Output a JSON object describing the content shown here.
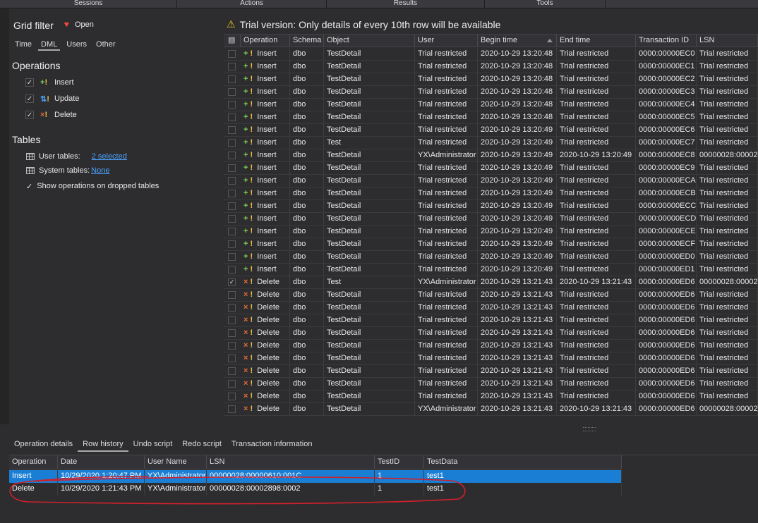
{
  "top_tabs": [
    "Sessions",
    "Actions",
    "Results",
    "Tools"
  ],
  "filter": {
    "title": "Grid filter",
    "open_label": "Open",
    "tabs": [
      "Time",
      "DML",
      "Users",
      "Other"
    ],
    "operations_heading": "Operations",
    "operations": [
      {
        "label": "Insert",
        "checked": true,
        "icon": "insert-icon"
      },
      {
        "label": "Update",
        "checked": true,
        "icon": "update-icon"
      },
      {
        "label": "Delete",
        "checked": true,
        "icon": "delete-icon"
      }
    ],
    "tables_heading": "Tables",
    "user_tables_label": "User tables:",
    "user_tables_value": "2 selected",
    "system_tables_label": "System tables:",
    "system_tables_value": "None",
    "show_dropped_label": "Show operations on dropped tables"
  },
  "banner": "Trial version: Only details of every 10th row will be available",
  "grid": {
    "columns": [
      "Operation",
      "Schema",
      "Object",
      "User",
      "Begin time",
      "End time",
      "Transaction ID",
      "LSN"
    ],
    "rows": [
      {
        "op": "Insert",
        "schema": "dbo",
        "object": "TestDetail",
        "user": "Trial restricted",
        "begin": "2020-10-29 13:20:48",
        "end": "Trial restricted",
        "tid": "0000:00000EC0",
        "lsn": "Trial restricted",
        "checked": false
      },
      {
        "op": "Insert",
        "schema": "dbo",
        "object": "TestDetail",
        "user": "Trial restricted",
        "begin": "2020-10-29 13:20:48",
        "end": "Trial restricted",
        "tid": "0000:00000EC1",
        "lsn": "Trial restricted",
        "checked": false
      },
      {
        "op": "Insert",
        "schema": "dbo",
        "object": "TestDetail",
        "user": "Trial restricted",
        "begin": "2020-10-29 13:20:48",
        "end": "Trial restricted",
        "tid": "0000:00000EC2",
        "lsn": "Trial restricted",
        "checked": false
      },
      {
        "op": "Insert",
        "schema": "dbo",
        "object": "TestDetail",
        "user": "Trial restricted",
        "begin": "2020-10-29 13:20:48",
        "end": "Trial restricted",
        "tid": "0000:00000EC3",
        "lsn": "Trial restricted",
        "checked": false
      },
      {
        "op": "Insert",
        "schema": "dbo",
        "object": "TestDetail",
        "user": "Trial restricted",
        "begin": "2020-10-29 13:20:48",
        "end": "Trial restricted",
        "tid": "0000:00000EC4",
        "lsn": "Trial restricted",
        "checked": false
      },
      {
        "op": "Insert",
        "schema": "dbo",
        "object": "TestDetail",
        "user": "Trial restricted",
        "begin": "2020-10-29 13:20:48",
        "end": "Trial restricted",
        "tid": "0000:00000EC5",
        "lsn": "Trial restricted",
        "checked": false
      },
      {
        "op": "Insert",
        "schema": "dbo",
        "object": "TestDetail",
        "user": "Trial restricted",
        "begin": "2020-10-29 13:20:49",
        "end": "Trial restricted",
        "tid": "0000:00000EC6",
        "lsn": "Trial restricted",
        "checked": false
      },
      {
        "op": "Insert",
        "schema": "dbo",
        "object": "Test",
        "user": "Trial restricted",
        "begin": "2020-10-29 13:20:49",
        "end": "Trial restricted",
        "tid": "0000:00000EC7",
        "lsn": "Trial restricted",
        "checked": false
      },
      {
        "op": "Insert",
        "schema": "dbo",
        "object": "TestDetail",
        "user": "YX\\Administrator",
        "begin": "2020-10-29 13:20:49",
        "end": "2020-10-29 13:20:49",
        "tid": "0000:00000EC8",
        "lsn": "00000028:00002",
        "checked": false
      },
      {
        "op": "Insert",
        "schema": "dbo",
        "object": "TestDetail",
        "user": "Trial restricted",
        "begin": "2020-10-29 13:20:49",
        "end": "Trial restricted",
        "tid": "0000:00000EC9",
        "lsn": "Trial restricted",
        "checked": false
      },
      {
        "op": "Insert",
        "schema": "dbo",
        "object": "TestDetail",
        "user": "Trial restricted",
        "begin": "2020-10-29 13:20:49",
        "end": "Trial restricted",
        "tid": "0000:00000ECA",
        "lsn": "Trial restricted",
        "checked": false
      },
      {
        "op": "Insert",
        "schema": "dbo",
        "object": "TestDetail",
        "user": "Trial restricted",
        "begin": "2020-10-29 13:20:49",
        "end": "Trial restricted",
        "tid": "0000:00000ECB",
        "lsn": "Trial restricted",
        "checked": false
      },
      {
        "op": "Insert",
        "schema": "dbo",
        "object": "TestDetail",
        "user": "Trial restricted",
        "begin": "2020-10-29 13:20:49",
        "end": "Trial restricted",
        "tid": "0000:00000ECC",
        "lsn": "Trial restricted",
        "checked": false
      },
      {
        "op": "Insert",
        "schema": "dbo",
        "object": "TestDetail",
        "user": "Trial restricted",
        "begin": "2020-10-29 13:20:49",
        "end": "Trial restricted",
        "tid": "0000:00000ECD",
        "lsn": "Trial restricted",
        "checked": false
      },
      {
        "op": "Insert",
        "schema": "dbo",
        "object": "TestDetail",
        "user": "Trial restricted",
        "begin": "2020-10-29 13:20:49",
        "end": "Trial restricted",
        "tid": "0000:00000ECE",
        "lsn": "Trial restricted",
        "checked": false
      },
      {
        "op": "Insert",
        "schema": "dbo",
        "object": "TestDetail",
        "user": "Trial restricted",
        "begin": "2020-10-29 13:20:49",
        "end": "Trial restricted",
        "tid": "0000:00000ECF",
        "lsn": "Trial restricted",
        "checked": false
      },
      {
        "op": "Insert",
        "schema": "dbo",
        "object": "TestDetail",
        "user": "Trial restricted",
        "begin": "2020-10-29 13:20:49",
        "end": "Trial restricted",
        "tid": "0000:00000ED0",
        "lsn": "Trial restricted",
        "checked": false
      },
      {
        "op": "Insert",
        "schema": "dbo",
        "object": "TestDetail",
        "user": "Trial restricted",
        "begin": "2020-10-29 13:20:49",
        "end": "Trial restricted",
        "tid": "0000:00000ED1",
        "lsn": "Trial restricted",
        "checked": false
      },
      {
        "op": "Delete",
        "schema": "dbo",
        "object": "Test",
        "user": "YX\\Administrator",
        "begin": "2020-10-29 13:21:43",
        "end": "2020-10-29 13:21:43",
        "tid": "0000:00000ED6",
        "lsn": "00000028:00002",
        "checked": true
      },
      {
        "op": "Delete",
        "schema": "dbo",
        "object": "TestDetail",
        "user": "Trial restricted",
        "begin": "2020-10-29 13:21:43",
        "end": "Trial restricted",
        "tid": "0000:00000ED6",
        "lsn": "Trial restricted",
        "checked": false
      },
      {
        "op": "Delete",
        "schema": "dbo",
        "object": "TestDetail",
        "user": "Trial restricted",
        "begin": "2020-10-29 13:21:43",
        "end": "Trial restricted",
        "tid": "0000:00000ED6",
        "lsn": "Trial restricted",
        "checked": false
      },
      {
        "op": "Delete",
        "schema": "dbo",
        "object": "TestDetail",
        "user": "Trial restricted",
        "begin": "2020-10-29 13:21:43",
        "end": "Trial restricted",
        "tid": "0000:00000ED6",
        "lsn": "Trial restricted",
        "checked": false
      },
      {
        "op": "Delete",
        "schema": "dbo",
        "object": "TestDetail",
        "user": "Trial restricted",
        "begin": "2020-10-29 13:21:43",
        "end": "Trial restricted",
        "tid": "0000:00000ED6",
        "lsn": "Trial restricted",
        "checked": false
      },
      {
        "op": "Delete",
        "schema": "dbo",
        "object": "TestDetail",
        "user": "Trial restricted",
        "begin": "2020-10-29 13:21:43",
        "end": "Trial restricted",
        "tid": "0000:00000ED6",
        "lsn": "Trial restricted",
        "checked": false
      },
      {
        "op": "Delete",
        "schema": "dbo",
        "object": "TestDetail",
        "user": "Trial restricted",
        "begin": "2020-10-29 13:21:43",
        "end": "Trial restricted",
        "tid": "0000:00000ED6",
        "lsn": "Trial restricted",
        "checked": false
      },
      {
        "op": "Delete",
        "schema": "dbo",
        "object": "TestDetail",
        "user": "Trial restricted",
        "begin": "2020-10-29 13:21:43",
        "end": "Trial restricted",
        "tid": "0000:00000ED6",
        "lsn": "Trial restricted",
        "checked": false
      },
      {
        "op": "Delete",
        "schema": "dbo",
        "object": "TestDetail",
        "user": "Trial restricted",
        "begin": "2020-10-29 13:21:43",
        "end": "Trial restricted",
        "tid": "0000:00000ED6",
        "lsn": "Trial restricted",
        "checked": false
      },
      {
        "op": "Delete",
        "schema": "dbo",
        "object": "TestDetail",
        "user": "Trial restricted",
        "begin": "2020-10-29 13:21:43",
        "end": "Trial restricted",
        "tid": "0000:00000ED6",
        "lsn": "Trial restricted",
        "checked": false
      },
      {
        "op": "Delete",
        "schema": "dbo",
        "object": "TestDetail",
        "user": "YX\\Administrator",
        "begin": "2020-10-29 13:21:43",
        "end": "2020-10-29 13:21:43",
        "tid": "0000:00000ED6",
        "lsn": "00000028:00002",
        "checked": false
      }
    ]
  },
  "bottom": {
    "tabs": [
      "Operation details",
      "Row history",
      "Undo script",
      "Redo script",
      "Transaction information"
    ],
    "active_tab": 1,
    "columns": [
      "Operation",
      "Date",
      "User Name",
      "LSN",
      "TestID",
      "TestData"
    ],
    "rows": [
      {
        "op": "Insert",
        "date": "10/29/2020 1:20:47 PM",
        "user": "YX\\Administrator",
        "lsn": "00000028:00000610:001C",
        "testid": "1",
        "testdata": "test1",
        "selected": true
      },
      {
        "op": "Delete",
        "date": "10/29/2020 1:21:43 PM",
        "user": "YX\\Administrator",
        "lsn": "00000028:00002898:0002",
        "testid": "1",
        "testdata": "test1",
        "selected": false
      }
    ]
  },
  "colors": {
    "selection": "#1a7fd4",
    "annotation": "#d0202a",
    "insert": "#7ed35a",
    "delete": "#e46b3a"
  }
}
